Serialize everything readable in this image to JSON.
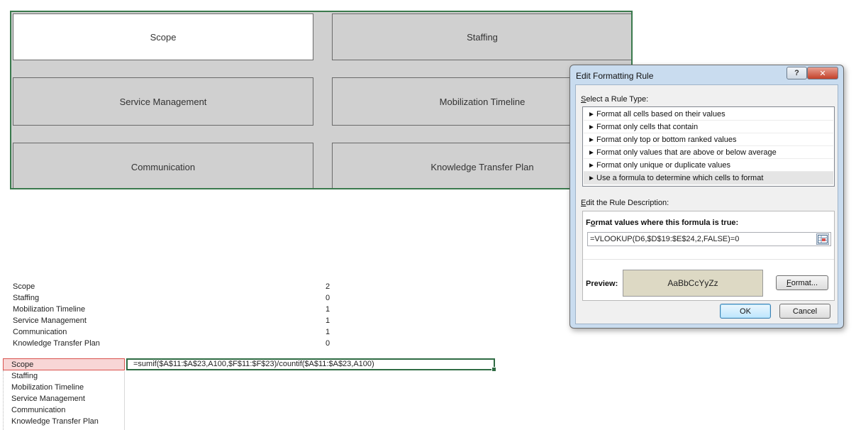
{
  "tiles": [
    {
      "label": "Scope",
      "active": true
    },
    {
      "label": "Staffing",
      "active": false
    },
    {
      "label": "Service Management",
      "active": false
    },
    {
      "label": "Mobilization Timeline",
      "active": false
    },
    {
      "label": "Communication",
      "active": false
    },
    {
      "label": "Knowledge Transfer Plan",
      "active": false
    }
  ],
  "summary_list": [
    {
      "name": "Scope",
      "value": "2"
    },
    {
      "name": "Staffing",
      "value": "0"
    },
    {
      "name": "Mobilization Timeline",
      "value": "1"
    },
    {
      "name": "Service Management",
      "value": "1"
    },
    {
      "name": "Communication",
      "value": "1"
    },
    {
      "name": "Knowledge Transfer Plan",
      "value": "0"
    }
  ],
  "lookup_list": [
    "Scope",
    "Staffing",
    "Mobilization Timeline",
    "Service Management",
    "Communication",
    "Knowledge Transfer Plan"
  ],
  "formula_cell": "=sumif($A$11:$A$23,A100,$F$11:$F$23)/countif($A$11:$A$23,A100)",
  "dialog": {
    "title": "Edit Formatting Rule",
    "help": "?",
    "close": "✕",
    "select_rule_type_label_u": "S",
    "select_rule_type_label_rest": "elect a Rule Type:",
    "rule_types": [
      "Format all cells based on their values",
      "Format only cells that contain",
      "Format only top or bottom ranked values",
      "Format only values that are above or below average",
      "Format only unique or duplicate values",
      "Use a formula to determine which cells to format"
    ],
    "selected_rule_index": 5,
    "edit_desc_label_u": "E",
    "edit_desc_label_rest": "dit the Rule Description:",
    "formula_label_pre": "F",
    "formula_label_u": "o",
    "formula_label_rest": "rmat values where this formula is true:",
    "formula_value": "=VLOOKUP(D6,$D$19:$E$24,2,FALSE)=0",
    "preview_label": "Preview:",
    "preview_text": "AaBbCcYyZz",
    "preview_color": "#ddd9c4",
    "format_button_u": "F",
    "format_button_rest": "ormat...",
    "ok": "OK",
    "cancel": "Cancel"
  }
}
